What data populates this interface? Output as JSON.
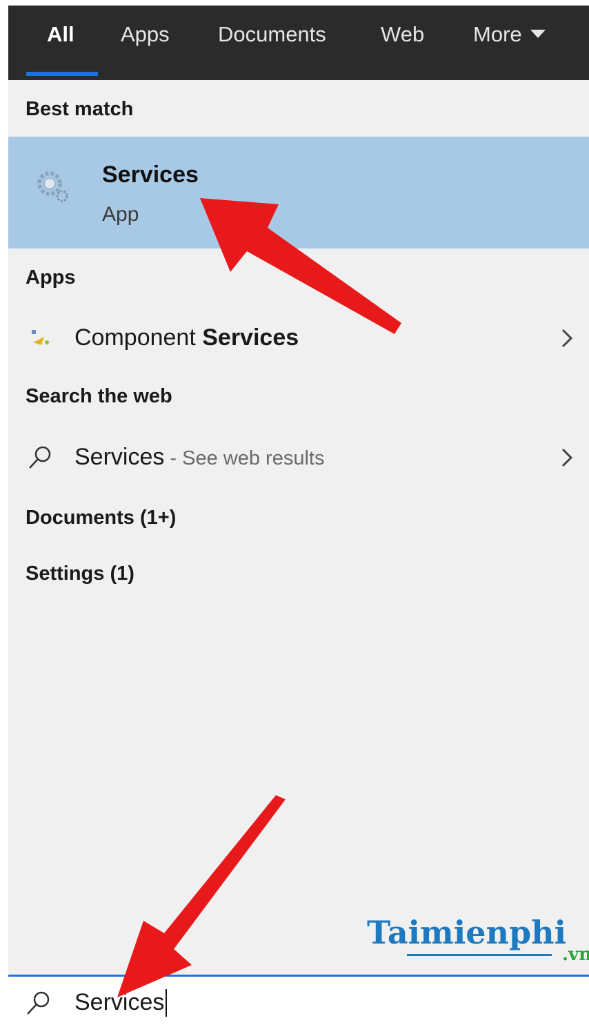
{
  "tabs": [
    {
      "label": "All",
      "active": true
    },
    {
      "label": "Apps",
      "active": false
    },
    {
      "label": "Documents",
      "active": false
    },
    {
      "label": "Web",
      "active": false
    },
    {
      "label": "More",
      "active": false
    }
  ],
  "sections": {
    "best_match": "Best match",
    "apps": "Apps",
    "search_web": "Search the web",
    "documents": "Documents (1+)",
    "settings": "Settings (1)"
  },
  "best_match_item": {
    "title": "Services",
    "subtitle": "App",
    "icon": "services-gear-icon"
  },
  "apps_items": [
    {
      "label_prefix": "Component ",
      "label_bold": "Services",
      "icon": "component-services-icon"
    }
  ],
  "web_items": [
    {
      "label": "Services",
      "suffix": " - See web results",
      "icon": "search-icon"
    }
  ],
  "search": {
    "value": "Services",
    "icon": "search-icon"
  },
  "watermark": {
    "main": "Taimienphi",
    "tld": ".vn"
  },
  "colors": {
    "tabbar_bg": "#2b2b2b",
    "accent": "#1a73d9",
    "selected_bg": "#a8c9e6",
    "panel_bg": "#f0f0f0",
    "annotation_arrow": "#e8191b"
  }
}
